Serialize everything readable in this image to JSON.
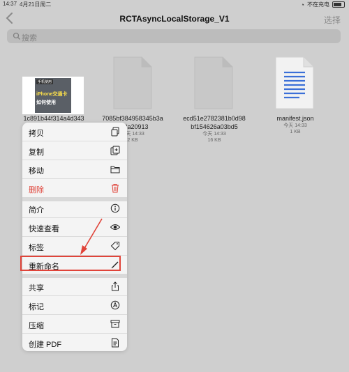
{
  "status": {
    "time": "14:37",
    "date": "4月21日周二",
    "charging": "不在充电"
  },
  "nav": {
    "title": "RCTAsyncLocalStorage_V1",
    "select": "选择"
  },
  "search": {
    "placeholder": "搜索"
  },
  "files": [
    {
      "name": "1c891b44f314a4d343",
      "meta": "",
      "size": ""
    },
    {
      "name_line1": "7085bf384958345b3a",
      "name_line2": "502a20913",
      "meta": "今天 14:33",
      "size": "2 KB"
    },
    {
      "name_line1": "ecd51e2782381b0d98",
      "name_line2": "bf154626a03bd5",
      "meta": "今天 14:33",
      "size": "16 KB"
    },
    {
      "name": "manifest.json",
      "meta": "今天 14:33",
      "size": "1 KB"
    }
  ],
  "thumb": {
    "tag": "手机使用",
    "line1": "iPhone交通卡",
    "line2": "如何使用"
  },
  "menu": {
    "copy": "拷贝",
    "duplicate": "复制",
    "move": "移动",
    "delete": "删除",
    "info": "简介",
    "quicklook": "快速查看",
    "tags": "标签",
    "rename": "重新命名",
    "share": "共享",
    "markup": "标记",
    "compress": "压缩",
    "create_pdf": "创建 PDF"
  },
  "colors": {
    "accent_red": "#e0443a",
    "menu_bg": "#f4f4f4",
    "page_bg": "#cfcfcf"
  }
}
